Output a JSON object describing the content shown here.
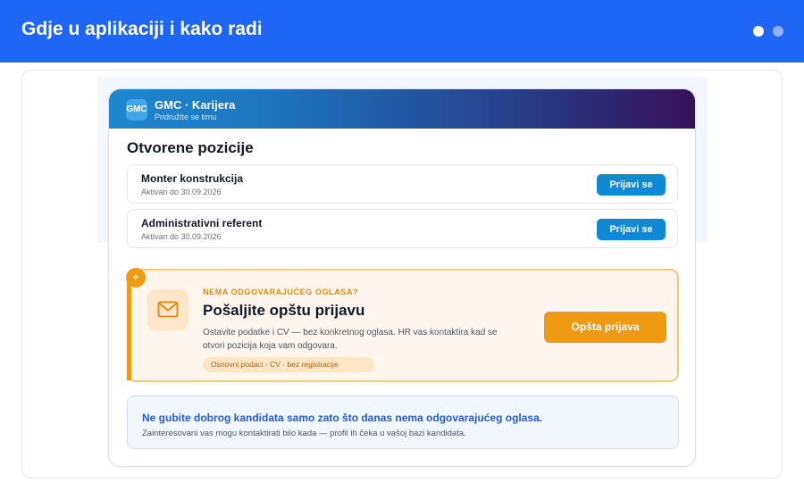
{
  "topbar": {
    "title": "Gdje u aplikaciji i kako radi"
  },
  "card": {
    "logo_text": "GMC",
    "brand": "GMC · Karijera",
    "brand_sub": "Pridružite se timu",
    "section_title": "Otvorene pozicije",
    "jobs": [
      {
        "title": "Monter konstrukcija",
        "meta": "Aktivan do 30.09.2026",
        "button": "Prijavi se"
      },
      {
        "title": "Administrativni referent",
        "meta": "Aktivan do 30.09.2026",
        "button": "Prijavi se"
      }
    ]
  },
  "promo": {
    "badge": "+",
    "kicker": "NEMA ODGOVARAJUĆEG OGLASA?",
    "title": "Pošaljite opštu prijavu",
    "description": "Ostavite podatke i CV — bez konkretnog oglasa. HR vas kontaktira kad se otvori pozicija koja vam odgovara.",
    "tag": "Osnovni podaci · CV · bez registracije",
    "button": "Opšta prijava",
    "icon": "mail-icon"
  },
  "info": {
    "title": "Ne gubite dobrog kandidata samo zato što danas nema odgovarajućeg oglasa.",
    "description": "Zainteresovani vas mogu kontaktirati bilo kada — profil ih čeka u vašoj bazi kandidata."
  },
  "colors": {
    "topbar": "#1f66f5",
    "accent_orange": "#ef9a13",
    "apply_blue": "#1089d4",
    "info_blue": "#1f5fd1"
  }
}
